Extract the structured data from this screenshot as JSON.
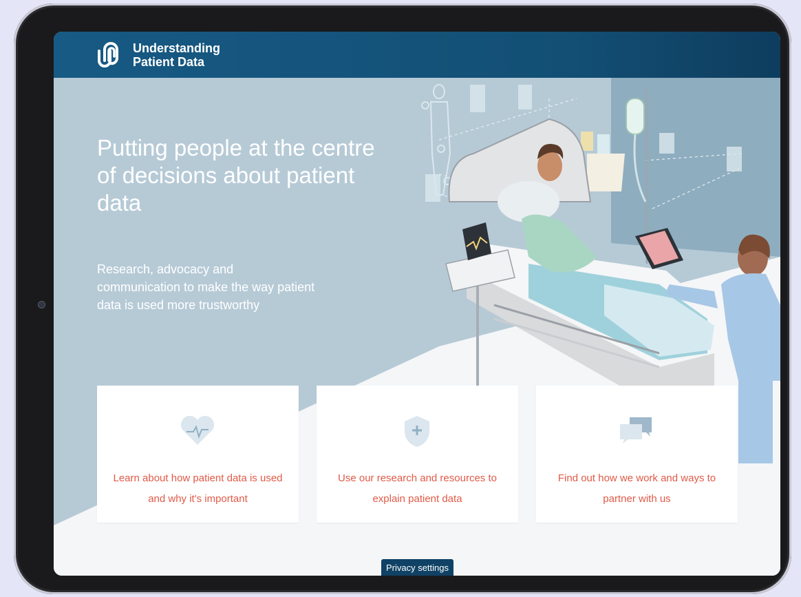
{
  "brand": {
    "line1": "Understanding",
    "line2": "Patient Data"
  },
  "hero": {
    "headline": "Putting people at the centre of decisions about patient data",
    "subtitle": "Research, advocacy and communication to make the way patient data is used more trustworthy"
  },
  "cards": [
    {
      "icon": "heart-pulse-icon",
      "text": "Learn about how patient data is used and why it's important"
    },
    {
      "icon": "shield-plus-icon",
      "text": "Use our research and resources to explain patient data"
    },
    {
      "icon": "chat-bubbles-icon",
      "text": "Find out how we work and ways to partner with us"
    }
  ],
  "privacy_button": "Privacy settings",
  "colors": {
    "header": "#175a84",
    "hero_bg": "#b6cad6",
    "accent": "#e05a47",
    "button": "#0f4265"
  }
}
